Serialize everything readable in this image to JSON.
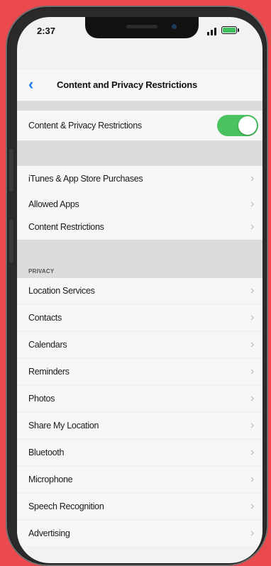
{
  "status": {
    "time": "2:37"
  },
  "nav": {
    "back_icon": "‹",
    "title": "Content and Privacy Restrictions"
  },
  "toggle_row": {
    "label": "Content & Privacy Restrictions",
    "on": true
  },
  "store_rows": [
    {
      "label": "iTunes & App Store Purchases"
    },
    {
      "label": "Allowed Apps"
    },
    {
      "label": "Content Restrictions"
    }
  ],
  "privacy": {
    "header": "PRIVACY",
    "rows": [
      {
        "label": "Location Services"
      },
      {
        "label": "Contacts"
      },
      {
        "label": "Calendars"
      },
      {
        "label": "Reminders"
      },
      {
        "label": "Photos"
      },
      {
        "label": "Share My Location"
      },
      {
        "label": "Bluetooth"
      },
      {
        "label": "Microphone"
      },
      {
        "label": "Speech Recognition"
      },
      {
        "label": "Advertising"
      }
    ]
  },
  "colors": {
    "accent": "#1d7cf2",
    "toggle_on": "#49c25f",
    "background": "#ea4a4e"
  },
  "icons": {
    "chevron": "chevron-right-icon"
  }
}
